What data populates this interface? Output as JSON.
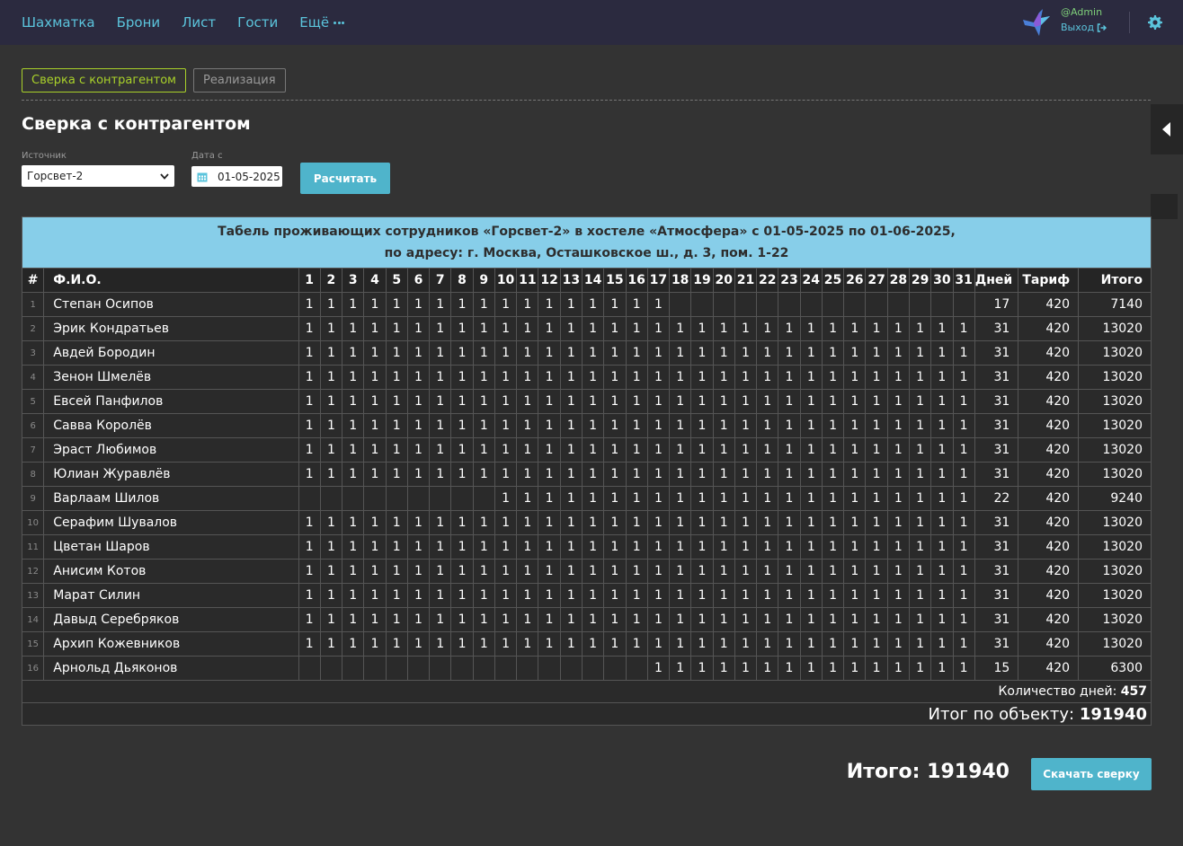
{
  "nav": {
    "items": [
      "Шахматка",
      "Брони",
      "Лист",
      "Гости"
    ],
    "more_label": "Ещё",
    "user": "@Admin",
    "logout": "Выход"
  },
  "tabs": [
    {
      "label": "Сверка с контрагентом",
      "active": true
    },
    {
      "label": "Реализация",
      "active": false
    }
  ],
  "page_title": "Сверка с контрагентом",
  "form": {
    "source_label": "Источник",
    "source_value": "Горсвет-2",
    "date_label": "Дата с",
    "date_value": "01-05-2025",
    "calc_button": "Расчитать"
  },
  "table": {
    "caption_line1": "Табель проживающих сотрудников «Горсвет-2» в хостеле «Атмосфера» с 01-05-2025 по 01-06-2025,",
    "caption_line2": "по адресу: г. Москва, Осташковское ш., д. 3, пом. 1-22",
    "headers": {
      "num": "#",
      "fio": "Ф.И.О.",
      "days": "Дней",
      "tariff": "Тариф",
      "total": "Итого"
    },
    "day_count": 31,
    "rows": [
      {
        "n": "1",
        "name": "Степан Осипов",
        "from": 1,
        "to": 17,
        "days": "17",
        "tariff": "420",
        "total": "7140"
      },
      {
        "n": "2",
        "name": "Эрик Кондратьев",
        "from": 1,
        "to": 31,
        "days": "31",
        "tariff": "420",
        "total": "13020"
      },
      {
        "n": "3",
        "name": "Авдей Бородин",
        "from": 1,
        "to": 31,
        "days": "31",
        "tariff": "420",
        "total": "13020"
      },
      {
        "n": "4",
        "name": "Зенон Шмелёв",
        "from": 1,
        "to": 31,
        "days": "31",
        "tariff": "420",
        "total": "13020"
      },
      {
        "n": "5",
        "name": "Евсей Панфилов",
        "from": 1,
        "to": 31,
        "days": "31",
        "tariff": "420",
        "total": "13020"
      },
      {
        "n": "6",
        "name": "Савва Королёв",
        "from": 1,
        "to": 31,
        "days": "31",
        "tariff": "420",
        "total": "13020"
      },
      {
        "n": "7",
        "name": "Эраст Любимов",
        "from": 1,
        "to": 31,
        "days": "31",
        "tariff": "420",
        "total": "13020"
      },
      {
        "n": "8",
        "name": "Юлиан Журавлёв",
        "from": 1,
        "to": 31,
        "days": "31",
        "tariff": "420",
        "total": "13020"
      },
      {
        "n": "9",
        "name": "Варлаам Шилов",
        "from": 10,
        "to": 31,
        "days": "22",
        "tariff": "420",
        "total": "9240"
      },
      {
        "n": "10",
        "name": "Серафим Шувалов",
        "from": 1,
        "to": 31,
        "days": "31",
        "tariff": "420",
        "total": "13020"
      },
      {
        "n": "11",
        "name": "Цветан Шаров",
        "from": 1,
        "to": 31,
        "days": "31",
        "tariff": "420",
        "total": "13020"
      },
      {
        "n": "12",
        "name": "Анисим Котов",
        "from": 1,
        "to": 31,
        "days": "31",
        "tariff": "420",
        "total": "13020"
      },
      {
        "n": "13",
        "name": "Марат Силин",
        "from": 1,
        "to": 31,
        "days": "31",
        "tariff": "420",
        "total": "13020"
      },
      {
        "n": "14",
        "name": "Давыд Серебряков",
        "from": 1,
        "to": 31,
        "days": "31",
        "tariff": "420",
        "total": "13020"
      },
      {
        "n": "15",
        "name": "Архип Кожевников",
        "from": 1,
        "to": 31,
        "days": "31",
        "tariff": "420",
        "total": "13020"
      },
      {
        "n": "16",
        "name": "Арнольд Дьяконов",
        "from": 17,
        "to": 31,
        "days": "15",
        "tariff": "420",
        "total": "6300"
      }
    ],
    "mark": "1",
    "days_total_label": "Количество дней:",
    "days_total_value": "457",
    "object_total_label": "Итог по объекту:",
    "object_total_value": "191940"
  },
  "grand_total_label": "Итого:",
  "grand_total_value": "191940",
  "download_button": "Скачать сверку",
  "colors": {
    "accent": "#4fb4cb",
    "active_tab": "#a9d12a",
    "caption_bg": "#87cee9",
    "nav_bg": "#2b2a3f"
  }
}
